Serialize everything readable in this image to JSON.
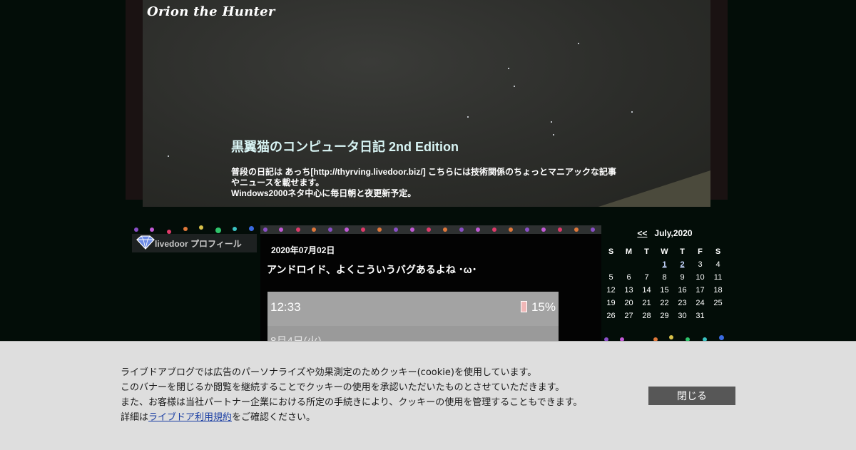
{
  "header": {
    "logo_text": "Orion the Hunter",
    "blog_title": "黒翼猫のコンピュータ日記 2nd Edition",
    "description_prefix": "普段の日記は あっち[",
    "description_link": "http://thyrving.livedoor.biz/",
    "description_suffix": "] こちらには技術関係のちょっとマニアックな記事やニュースを載せます。",
    "description_line2": "Windows2000ネタ中心に毎日朝と夜更新予定。"
  },
  "sidebar": {
    "profile_label": "livedoor プロフィール"
  },
  "post": {
    "date": "2020年07月02日",
    "title": "アンドロイド、よくこういうバグあるよね ･ω･",
    "screenshot_time": "12:33",
    "screenshot_battery": "15%",
    "screenshot_sub": "8月4日(火)"
  },
  "calendar": {
    "prev_label": "<<",
    "month_label": "July,2020",
    "weekdays": [
      "S",
      "M",
      "T",
      "W",
      "T",
      "F",
      "S"
    ],
    "weeks": [
      [
        "",
        "",
        "",
        "1",
        "2",
        "3",
        "4"
      ],
      [
        "5",
        "6",
        "7",
        "8",
        "9",
        "10",
        "11"
      ],
      [
        "12",
        "13",
        "14",
        "15",
        "16",
        "17",
        "18"
      ],
      [
        "19",
        "20",
        "21",
        "22",
        "23",
        "24",
        "25"
      ],
      [
        "26",
        "27",
        "28",
        "29",
        "30",
        "31",
        ""
      ]
    ],
    "linked_days": [
      "1",
      "2"
    ]
  },
  "cookie_banner": {
    "line1": "ライブドアブログでは広告のパーソナライズや効果測定のためクッキー(cookie)を使用しています。",
    "line2": "このバナーを閉じるか閲覧を継続することでクッキーの使用を承認いただいたものとさせていただきます。",
    "line3": "また、お客様は当社パートナー企業における所定の手続きにより、クッキーの使用を管理することもできます。",
    "line4_prefix": "詳細は",
    "line4_link": "ライブドア利用規約",
    "line4_suffix": "をご確認ください。",
    "close_label": "閉じる"
  },
  "colors": {
    "background": "#030d08",
    "title_color": "#d8f4f4",
    "banner_bg": "#dedede",
    "close_button_bg": "#575757",
    "link_color": "#1a3ea3"
  }
}
